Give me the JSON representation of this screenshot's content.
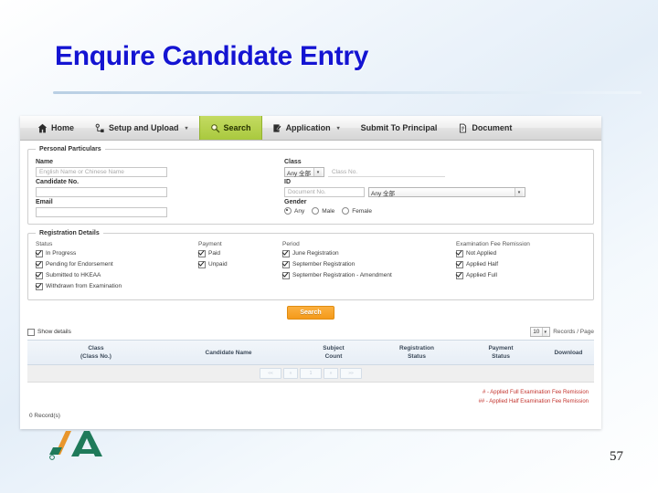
{
  "slide": {
    "title": "Enquire Candidate Entry",
    "page_number": "57",
    "title_color": "#1414d2"
  },
  "app": {
    "nav": {
      "items": [
        {
          "label": "Home",
          "icon": "home-icon",
          "caret": "",
          "active": false
        },
        {
          "label": "Setup and Upload",
          "icon": "setup-upload-icon",
          "caret": "▾",
          "active": false
        },
        {
          "label": "Search",
          "icon": "magnifier-icon",
          "caret": "",
          "active": true
        },
        {
          "label": "Application",
          "icon": "document-edit-icon",
          "caret": "▾",
          "active": false
        },
        {
          "label": "Submit To Principal",
          "icon": "",
          "caret": "",
          "active": false
        },
        {
          "label": "Document",
          "icon": "file-icon",
          "caret": "",
          "active": false
        }
      ],
      "active_color": "#a9c93e"
    },
    "personal_particulars": {
      "legend": "Personal Particulars",
      "name_label": "Name",
      "name_placeholder": "English Name or Chinese Name",
      "name_value": "",
      "candidate_no_label": "Candidate No.",
      "candidate_no_value": "",
      "email_label": "Email",
      "email_value": "",
      "class_label": "Class",
      "class_select_value": "Any 全部",
      "class_no_placeholder": "Class No.",
      "class_no_value": "",
      "id_label": "ID",
      "document_no_placeholder": "Document No.",
      "document_no_value": "",
      "id_type_select_value": "Any 全部",
      "gender_label": "Gender",
      "gender_options": [
        {
          "label": "Any",
          "selected": true
        },
        {
          "label": "Male",
          "selected": false
        },
        {
          "label": "Female",
          "selected": false
        }
      ]
    },
    "registration_details": {
      "legend": "Registration Details",
      "status": {
        "title": "Status",
        "items": [
          {
            "label": "In Progress",
            "checked": true
          },
          {
            "label": "Pending for Endorsement",
            "checked": true
          },
          {
            "label": "Submitted to HKEAA",
            "checked": true
          },
          {
            "label": "Withdrawn from Examination",
            "checked": true
          }
        ]
      },
      "payment": {
        "title": "Payment",
        "items": [
          {
            "label": "Paid",
            "checked": true
          },
          {
            "label": "Unpaid",
            "checked": true
          }
        ]
      },
      "period": {
        "title": "Period",
        "items": [
          {
            "label": "June Registration",
            "checked": true
          },
          {
            "label": "September Registration",
            "checked": true
          },
          {
            "label": "September Registration - Amendment",
            "checked": true
          }
        ]
      },
      "remission": {
        "title": "Examination Fee Remission",
        "items": [
          {
            "label": "Not Applied",
            "checked": true
          },
          {
            "label": "Applied Half",
            "checked": true
          },
          {
            "label": "Applied Full",
            "checked": true
          }
        ]
      }
    },
    "search_button": "Search",
    "results": {
      "show_details_label": "Show details",
      "show_details_checked": false,
      "records_per_page_value": "10",
      "records_per_page_label": "Records / Page",
      "columns": [
        {
          "main": "Class",
          "sub": "(Class No.)",
          "sortable": true
        },
        {
          "main": "Candidate Name",
          "sub": "",
          "sortable": true
        },
        {
          "main": "Subject",
          "sub": "Count",
          "sortable": true
        },
        {
          "main": "Registration",
          "sub": "Status",
          "sortable": true
        },
        {
          "main": "Payment",
          "sub": "Status",
          "sortable": true
        },
        {
          "main": "Download",
          "sub": "",
          "sortable": false
        }
      ],
      "rows": [],
      "pager": [
        "««",
        "«",
        "1",
        "»",
        "»»"
      ],
      "record_count": "0 Record(s)",
      "footnotes": [
        "# - Applied Full Examination Fee Remission",
        "## - Applied Half Examination Fee Remission"
      ],
      "footnote_color": "#c3342e"
    }
  }
}
